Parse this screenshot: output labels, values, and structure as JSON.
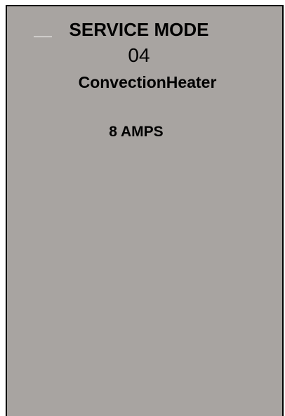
{
  "screen": {
    "title": "SERVICE MODE",
    "mode_number": "04",
    "component_name": "ConvectionHeater",
    "reading": "8 AMPS"
  },
  "colors": {
    "panel_background": "#a8a4a1",
    "border": "#000000",
    "text": "#000000"
  }
}
